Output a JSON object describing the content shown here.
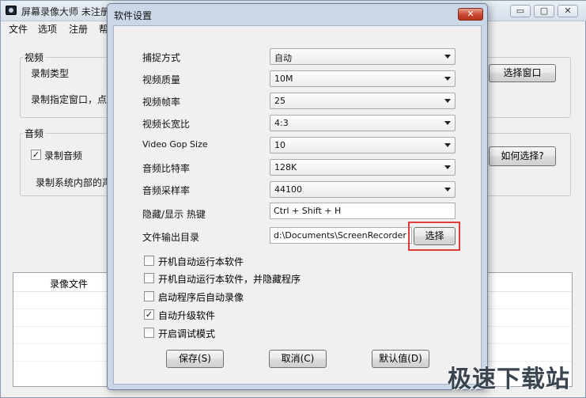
{
  "main_window": {
    "title": "屏幕录像大师 未注册",
    "controls": {
      "minimize": "▭",
      "maximize": "▢",
      "close": "✕"
    },
    "menu": [
      "文件",
      "选项",
      "注册",
      "帮"
    ],
    "video_group": {
      "legend": "视频",
      "record_type_label": "录制类型",
      "record_window_text": "录制指定窗口，点击",
      "select_window_button": "选择窗口"
    },
    "audio_group": {
      "legend": "音频",
      "record_audio_label": "录制音频",
      "record_audio_checked": true,
      "system_audio_text": "录制系统内部的声",
      "how_to_select_button": "如何选择?"
    },
    "file_list": {
      "column_header": "录像文件"
    }
  },
  "dialog": {
    "title": "软件设置",
    "close_icon": "✕",
    "fields": [
      {
        "label": "捕捉方式",
        "value": "自动"
      },
      {
        "label": "视频质量",
        "value": "10M"
      },
      {
        "label": "视频帧率",
        "value": "25"
      },
      {
        "label": "视频长宽比",
        "value": "4:3"
      },
      {
        "label": "Video Gop Size",
        "value": "10"
      },
      {
        "label": "音频比特率",
        "value": "128K"
      },
      {
        "label": "音频采样率",
        "value": "44100"
      }
    ],
    "hotkey": {
      "label": "隐藏/显示 热键",
      "value": "Ctrl + Shift + H"
    },
    "output_dir": {
      "label": "文件输出目录",
      "value": "d:\\Documents\\ScreenRecorder",
      "browse_button": "选择"
    },
    "options": [
      {
        "label": "开机自动运行本软件",
        "checked": false
      },
      {
        "label": "开机自动运行本软件，并隐藏程序",
        "checked": false
      },
      {
        "label": "启动程序后自动录像",
        "checked": false
      },
      {
        "label": "自动升级软件",
        "checked": true
      },
      {
        "label": "开启调试模式",
        "checked": false
      }
    ],
    "buttons": {
      "save": "保存(S)",
      "cancel": "取消(C)",
      "default": "默认值(D)"
    }
  },
  "watermark": "极速下载站",
  "colors": {
    "highlight": "#e03a3a",
    "dialog_frame": "#c9d7e6"
  }
}
